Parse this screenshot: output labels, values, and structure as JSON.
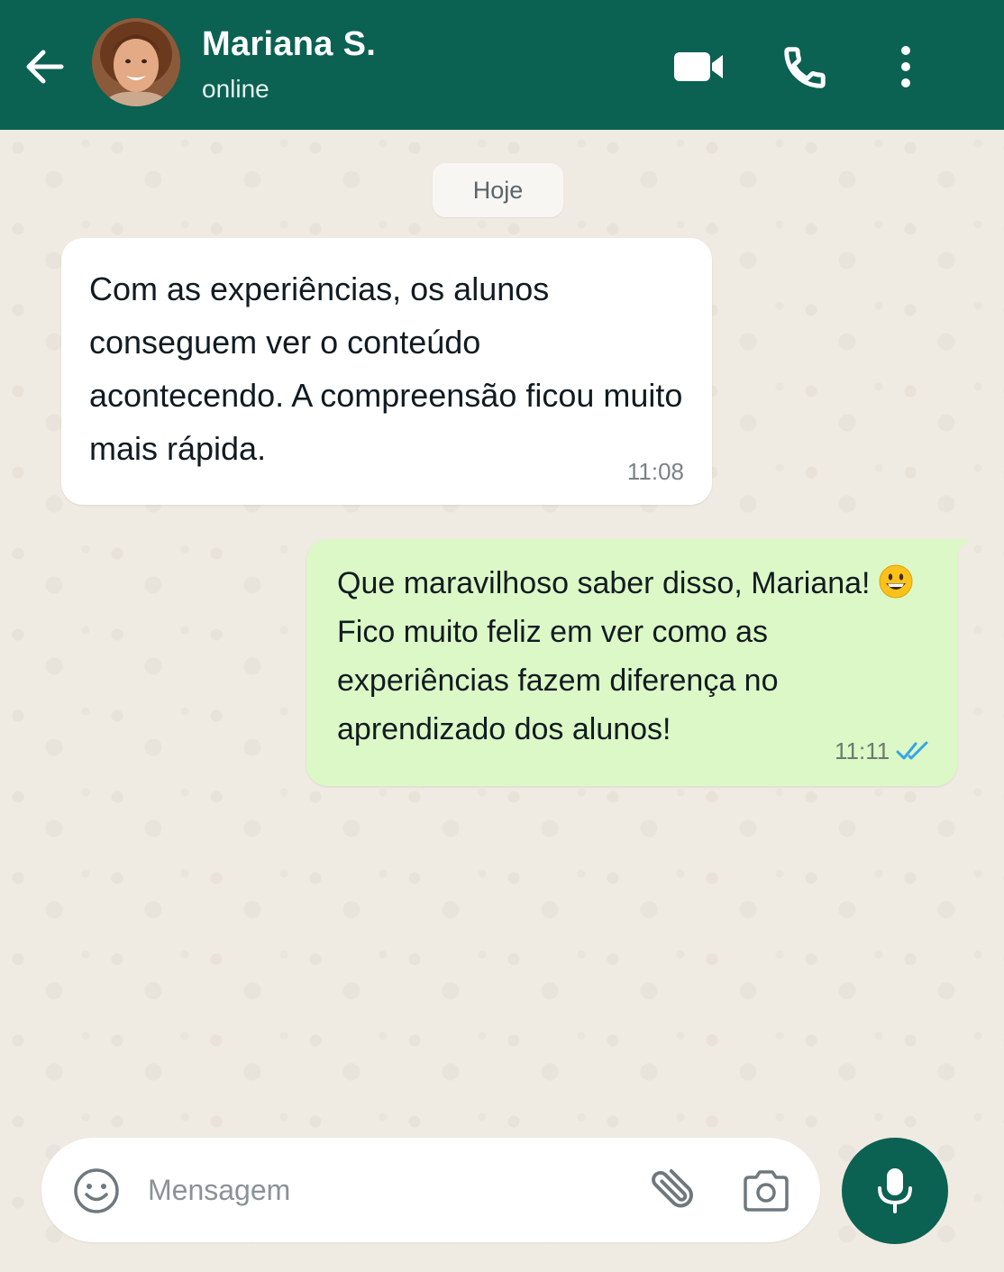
{
  "header": {
    "contact_name": "Mariana S.",
    "status": "online",
    "color": "#0b6152",
    "icons": {
      "back": "arrow-left-icon",
      "video": "video-camera-icon",
      "call": "phone-icon",
      "menu": "more-vertical-icon"
    }
  },
  "chat": {
    "date_label": "Hoje",
    "messages": [
      {
        "direction": "incoming",
        "text": "Com as experiências, os alunos conseguem ver o conteúdo acontecendo. A compreensão ficou muito mais rápida.",
        "time": "11:08"
      },
      {
        "direction": "outgoing",
        "text": "Que maravilhoso saber disso, Mariana!",
        "text_rest": "Fico muito feliz em ver como as experiências fazem diferença no aprendizado dos alunos!",
        "emoji": "grinning-face-emoji",
        "time": "11:11",
        "read_status": "double-check-read-icon"
      }
    ]
  },
  "composer": {
    "placeholder": "Mensagem",
    "icons": {
      "emoji": "smiley-icon",
      "attach": "paperclip-icon",
      "camera": "camera-icon",
      "mic": "microphone-icon"
    }
  },
  "colors": {
    "incoming_bubble": "#ffffff",
    "outgoing_bubble": "#dcf8c6",
    "read_ticks": "#34b7f1",
    "wallpaper": "#efeae2"
  }
}
